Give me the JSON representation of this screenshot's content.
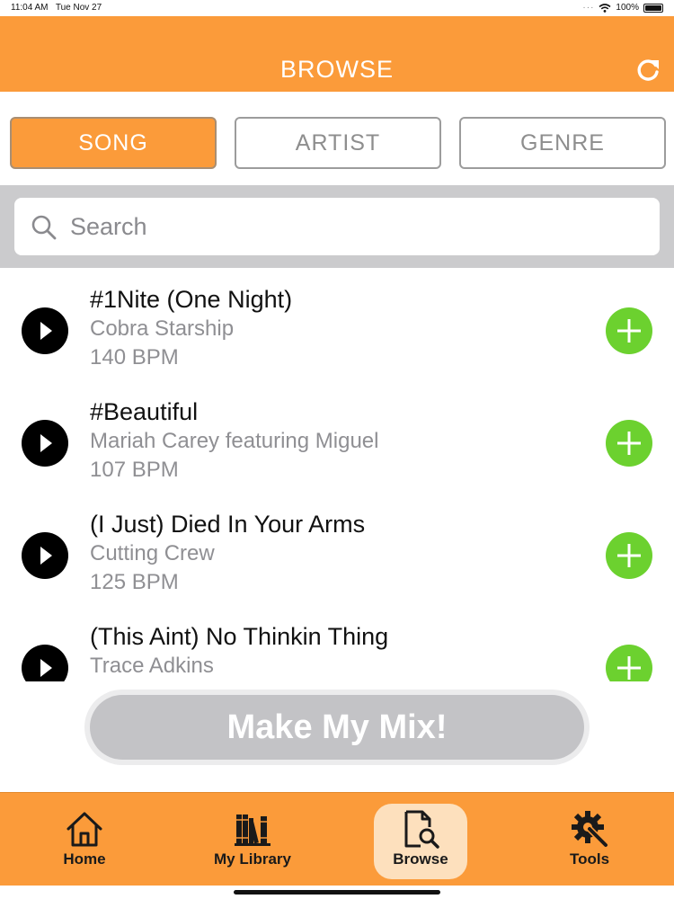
{
  "status_bar": {
    "time": "11:04 AM",
    "date": "Tue Nov 27",
    "signal_dots": "···",
    "battery": "100%"
  },
  "header": {
    "title": "BROWSE",
    "refresh_icon": "refresh-icon",
    "color": "#fb9b3a"
  },
  "segments": {
    "items": [
      "SONG",
      "ARTIST",
      "GENRE"
    ],
    "selected": "SONG"
  },
  "search": {
    "placeholder": "Search",
    "value": ""
  },
  "songs": [
    {
      "title": "#1Nite (One Night)",
      "artist": "Cobra Starship",
      "bpm": "140 BPM"
    },
    {
      "title": "#Beautiful",
      "artist": "Mariah Carey featuring Miguel",
      "bpm": "107 BPM"
    },
    {
      "title": "(I Just) Died In Your Arms",
      "artist": "Cutting Crew",
      "bpm": "125 BPM"
    },
    {
      "title": "(This Aint) No Thinkin Thing",
      "artist": "Trace Adkins",
      "bpm": ""
    }
  ],
  "mix_button": {
    "label": "Make My Mix!"
  },
  "tabs": [
    {
      "label": "Home",
      "icon": "home-icon"
    },
    {
      "label": "My Library",
      "icon": "library-icon"
    },
    {
      "label": "Browse",
      "icon": "browse-icon"
    },
    {
      "label": "Tools",
      "icon": "tools-icon"
    }
  ],
  "selected_tab": "Browse",
  "colors": {
    "accent": "#fb9b3a",
    "add_button": "#6cd12f",
    "active_tab_bg": "#fde0bd"
  }
}
